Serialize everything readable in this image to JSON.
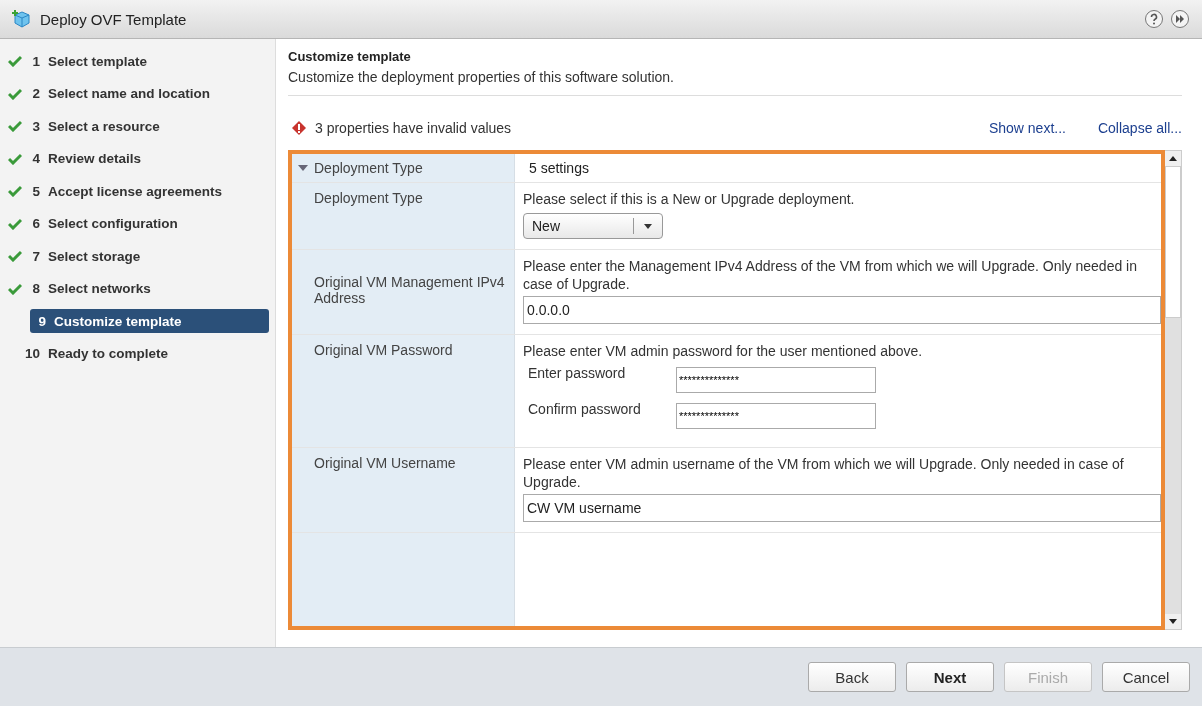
{
  "window": {
    "title": "Deploy OVF Template"
  },
  "steps": [
    {
      "number": "1",
      "label": "Select template",
      "completed": true,
      "selected": false
    },
    {
      "number": "2",
      "label": "Select name and location",
      "completed": true,
      "selected": false
    },
    {
      "number": "3",
      "label": "Select a resource",
      "completed": true,
      "selected": false
    },
    {
      "number": "4",
      "label": "Review details",
      "completed": true,
      "selected": false
    },
    {
      "number": "5",
      "label": "Accept license agreements",
      "completed": true,
      "selected": false
    },
    {
      "number": "6",
      "label": "Select configuration",
      "completed": true,
      "selected": false
    },
    {
      "number": "7",
      "label": "Select storage",
      "completed": true,
      "selected": false
    },
    {
      "number": "8",
      "label": "Select networks",
      "completed": true,
      "selected": false
    },
    {
      "number": "9",
      "label": "Customize template",
      "completed": false,
      "selected": true
    },
    {
      "number": "10",
      "label": "Ready to complete",
      "completed": false,
      "selected": false
    }
  ],
  "page": {
    "title": "Customize template",
    "subtitle": "Customize the deployment properties of this software solution."
  },
  "validation": {
    "message": "3 properties have invalid values"
  },
  "links": [
    "Show next...",
    "Collapse all..."
  ],
  "group": {
    "name": "Deployment Type",
    "expanded": true,
    "summary": "5 settings"
  },
  "properties": [
    {
      "kind": "select",
      "label": "Deployment Type",
      "description": "Please select if this is a New or Upgrade deployment.",
      "value": "New"
    },
    {
      "kind": "text",
      "label": "Original VM Management IPv4 Address",
      "description": "Please enter the Management IPv4 Address of the VM from which we will Upgrade. Only needed in case of Upgrade.",
      "value": "0.0.0.0"
    },
    {
      "kind": "password",
      "label": "Original VM Password",
      "description": "Please enter VM admin password for the user mentioned above.",
      "fields": [
        {
          "label": "Enter password",
          "value": "**************"
        },
        {
          "label": "Confirm password",
          "value": "**************"
        }
      ]
    },
    {
      "kind": "text",
      "label": "Original VM Username",
      "description": "Please enter VM admin username of the VM from which we will Upgrade. Only needed in case of Upgrade.",
      "value": "CW VM username"
    }
  ],
  "buttons": [
    {
      "label": "Back",
      "primary": false,
      "disabled": false
    },
    {
      "label": "Next",
      "primary": true,
      "disabled": false
    },
    {
      "label": "Finish",
      "primary": false,
      "disabled": true
    },
    {
      "label": "Cancel",
      "primary": false,
      "disabled": false
    }
  ]
}
